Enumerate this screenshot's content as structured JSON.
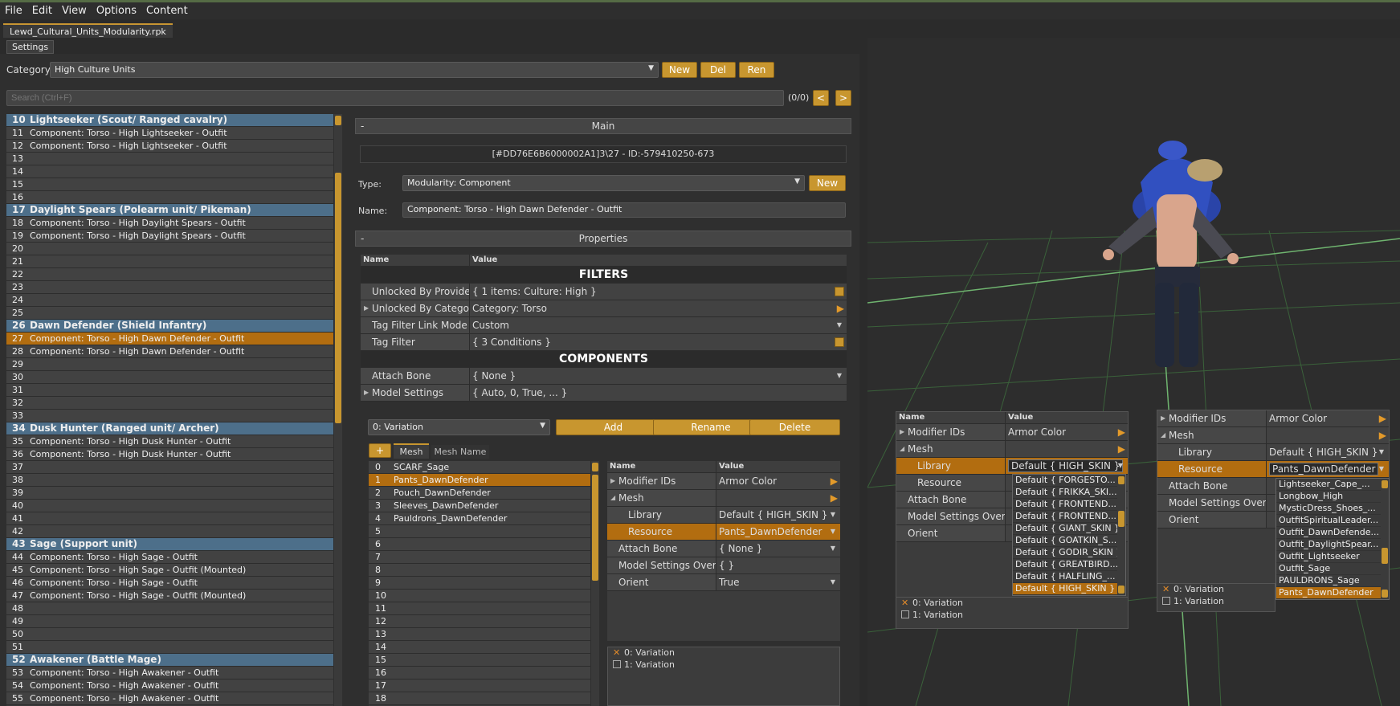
{
  "menu": [
    "File",
    "Edit",
    "View",
    "Options",
    "Content"
  ],
  "file_tab": "Lewd_Cultural_Units_Modularity.rpk",
  "settings_tab": "Settings",
  "category": {
    "label": "Category:",
    "value": "High Culture Units",
    "new": "New",
    "del": "Del",
    "ren": "Ren"
  },
  "search": {
    "placeholder": "Search (Ctrl+F)",
    "count": "(0/0)",
    "prev": "<",
    "next": ">"
  },
  "list": [
    {
      "n": "10",
      "t": "Lightseeker (Scout/ Ranged cavalry)",
      "kind": "head"
    },
    {
      "n": "11",
      "t": "Component: Torso - High Lightseeker - Outfit"
    },
    {
      "n": "12",
      "t": "Component: Torso - High Lightseeker - Outfit"
    },
    {
      "n": "13",
      "t": ""
    },
    {
      "n": "14",
      "t": ""
    },
    {
      "n": "15",
      "t": ""
    },
    {
      "n": "16",
      "t": ""
    },
    {
      "n": "17",
      "t": "Daylight Spears (Polearm unit/ Pikeman)",
      "kind": "head"
    },
    {
      "n": "18",
      "t": "Component: Torso - High Daylight Spears - Outfit"
    },
    {
      "n": "19",
      "t": "Component: Torso - High Daylight Spears - Outfit"
    },
    {
      "n": "20",
      "t": ""
    },
    {
      "n": "21",
      "t": ""
    },
    {
      "n": "22",
      "t": ""
    },
    {
      "n": "23",
      "t": ""
    },
    {
      "n": "24",
      "t": ""
    },
    {
      "n": "25",
      "t": ""
    },
    {
      "n": "26",
      "t": "Dawn Defender (Shield Infantry)",
      "kind": "head"
    },
    {
      "n": "27",
      "t": "Component: Torso - High Dawn Defender - Outfit",
      "kind": "sel"
    },
    {
      "n": "28",
      "t": "Component: Torso - High Dawn Defender - Outfit"
    },
    {
      "n": "29",
      "t": ""
    },
    {
      "n": "30",
      "t": ""
    },
    {
      "n": "31",
      "t": ""
    },
    {
      "n": "32",
      "t": ""
    },
    {
      "n": "33",
      "t": ""
    },
    {
      "n": "34",
      "t": "Dusk Hunter (Ranged unit/ Archer)",
      "kind": "head"
    },
    {
      "n": "35",
      "t": "Component: Torso - High Dusk Hunter - Outfit"
    },
    {
      "n": "36",
      "t": "Component: Torso - High Dusk Hunter - Outfit"
    },
    {
      "n": "37",
      "t": ""
    },
    {
      "n": "38",
      "t": ""
    },
    {
      "n": "39",
      "t": ""
    },
    {
      "n": "40",
      "t": ""
    },
    {
      "n": "41",
      "t": ""
    },
    {
      "n": "42",
      "t": ""
    },
    {
      "n": "43",
      "t": "Sage (Support unit)",
      "kind": "head"
    },
    {
      "n": "44",
      "t": "Component: Torso - High Sage - Outfit"
    },
    {
      "n": "45",
      "t": "Component: Torso - High Sage - Outfit (Mounted)"
    },
    {
      "n": "46",
      "t": "Component: Torso - High Sage - Outfit"
    },
    {
      "n": "47",
      "t": "Component: Torso - High Sage - Outfit (Mounted)"
    },
    {
      "n": "48",
      "t": ""
    },
    {
      "n": "49",
      "t": ""
    },
    {
      "n": "50",
      "t": ""
    },
    {
      "n": "51",
      "t": ""
    },
    {
      "n": "52",
      "t": "Awakener (Battle Mage)",
      "kind": "head"
    },
    {
      "n": "53",
      "t": "Component: Torso - High Awakener - Outfit"
    },
    {
      "n": "54",
      "t": "Component: Torso - High Awakener - Outfit"
    },
    {
      "n": "55",
      "t": "Component: Torso - High Awakener - Outfit"
    }
  ],
  "main": {
    "title": "Main",
    "collapse": "-",
    "id": "[#DD76E6B6000002A1]3\\27 - ID:-579410250-673",
    "type_label": "Type:",
    "type_value": "Modularity: Component",
    "type_new": "New",
    "name_label": "Name:",
    "name_value": "Component: Torso - High Dawn Defender - Outfit"
  },
  "properties": {
    "title": "Properties",
    "collapse": "-",
    "col_name": "Name",
    "col_value": "Value",
    "filters": "FILTERS",
    "unlocked_providers": {
      "n": "Unlocked By Providers",
      "v": "{ 1 items: Culture: High }"
    },
    "unlocked_category": {
      "n": "Unlocked By Category",
      "v": "Category: Torso"
    },
    "tag_mode": {
      "n": "Tag Filter Link Mode",
      "v": "Custom"
    },
    "tag_filter": {
      "n": "Tag Filter",
      "v": "{ 3 Conditions }"
    },
    "components": "COMPONENTS",
    "attach_bone": {
      "n": "Attach Bone",
      "v": "{ None }"
    },
    "model_settings": {
      "n": "Model Settings",
      "v": "{ Auto, 0, True, ... }"
    }
  },
  "variation": {
    "value": "0: Variation",
    "add": "Add",
    "rename": "Rename",
    "delete": "Delete"
  },
  "mesh_tabs": {
    "plus": "+",
    "mesh": "Mesh",
    "mesh_name": "Mesh Name"
  },
  "mesh_list": [
    "SCARF_Sage",
    "Pants_DawnDefender",
    "Pouch_DawnDefender",
    "Sleeves_DawnDefender",
    "Pauldrons_DawnDefender",
    "",
    "",
    "",
    "",
    "",
    "",
    "",
    "",
    "",
    "",
    "",
    "",
    "",
    ""
  ],
  "mesh_props": {
    "col_name": "Name",
    "col_value": "Value",
    "modifier_ids": {
      "n": "Modifier IDs",
      "v": "Armor Color"
    },
    "mesh": "Mesh",
    "library": {
      "n": "Library",
      "v": "Default { HIGH_SKIN }"
    },
    "resource": {
      "n": "Resource",
      "v": "Pants_DawnDefender"
    },
    "attach_bone": {
      "n": "Attach Bone",
      "v": "{ None }"
    },
    "model_override": {
      "n": "Model Settings Override",
      "v": "{  }"
    },
    "orient": {
      "n": "Orient",
      "v": "True"
    }
  },
  "variations": [
    "0: Variation",
    "1: Variation"
  ],
  "overlay1": {
    "library_value": "Default { HIGH_SKIN }",
    "dropdown": [
      "Default { FORGESTO...",
      "Default { FRIKKA_SKI...",
      "Default { FRONTEND...",
      "Default { FRONTEND...",
      "Default { GIANT_SKIN }",
      "Default { GOATKIN_S...",
      "Default { GODIR_SKIN }",
      "Default { GREATBIRD...",
      "Default { HALFLING_...",
      "Default { HIGH_SKIN }"
    ]
  },
  "overlay2": {
    "resource_value": "Pants_DawnDefender",
    "dropdown": [
      "Lightseeker_Cape_...",
      "Longbow_High",
      "MysticDress_Shoes_...",
      "OutfitSpiritualLeader...",
      "Outfit_DawnDefende...",
      "Outfit_DaylightSpear...",
      "Outfit_Lightseeker",
      "Outfit_Sage",
      "PAULDRONS_Sage",
      "Pants_DawnDefender"
    ]
  },
  "colors": {
    "accent": "#c8962f",
    "selected": "#b26d10",
    "header": "#4d6f8a"
  }
}
